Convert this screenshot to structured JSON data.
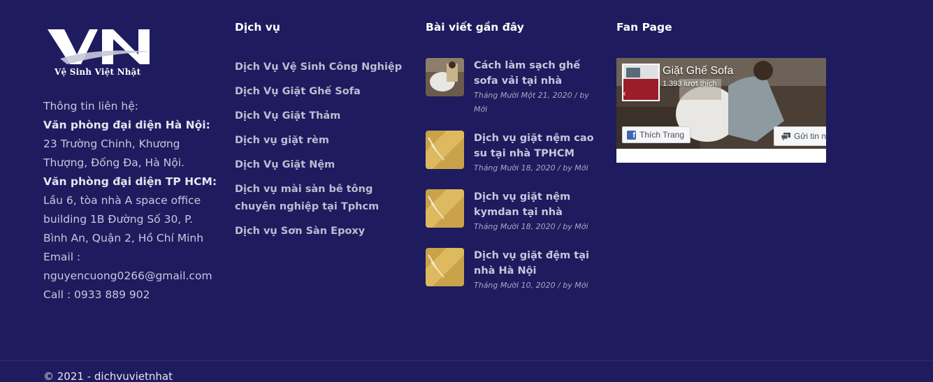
{
  "brand": {
    "logo_letters": "VN",
    "logo_tagline": "Vệ Sinh Việt Nhật"
  },
  "contact": {
    "intro": "Thông tin liên hệ:",
    "hanoi_label": "Văn phòng đại diện Hà Nội:",
    "hanoi_address": " 23 Trường Chinh, Khương Thượng, Đống Đa, Hà Nội.",
    "hcm_label": "Văn phòng đại diện TP HCM:",
    "hcm_address": "Lầu 6, tòa nhà A space office building 1B Đường Số 30, P. Bình An, Quận 2, Hồ Chí Minh",
    "email_label": "Email :",
    "email_value": "nguyencuong0266@gmail.com",
    "call": "Call : 0933 889 902"
  },
  "services": {
    "heading": "Dịch vụ",
    "items": [
      "Dịch Vụ Vệ Sinh Công Nghiệp",
      "Dịch Vụ Giặt Ghế Sofa",
      "Dịch Vụ Giặt Thảm",
      "Dịch vụ giặt rèm",
      "Dịch Vụ Giặt Nệm",
      "Dịch vụ mài sàn bê tông chuyên nghiệp tại Tphcm",
      "Dịch vụ Sơn Sàn Epoxy"
    ]
  },
  "recent_posts": {
    "heading": "Bài viết gần đây",
    "items": [
      {
        "title": "Cách làm sạch ghế sofa vải tại nhà",
        "meta": "Tháng Mười Một 21, 2020 / by Mới"
      },
      {
        "title": "Dịch vụ giặt nệm cao su tại nhà TPHCM",
        "meta": "Tháng Mười 18, 2020 / by Mới"
      },
      {
        "title": "Dịch vụ giặt nệm kymdan tại nhà",
        "meta": "Tháng Mười 18, 2020 / by Mới"
      },
      {
        "title": "Dịch vụ giặt đệm tại nhà Hà Nội",
        "meta": "Tháng Mười 10, 2020 / by Mới"
      }
    ]
  },
  "fanpage": {
    "heading": "Fan Page",
    "page_name": "Giặt Ghế Sofa",
    "likes": "1.393 lượt thích",
    "like_button": "Thích Trang",
    "message_button": "Gửi tin n"
  },
  "footer": {
    "copyright": "© 2021 - dichvuvietnhat"
  },
  "colors": {
    "background": "#1e1b5e",
    "heading": "#ffffff",
    "link": "#bdbcd2"
  }
}
